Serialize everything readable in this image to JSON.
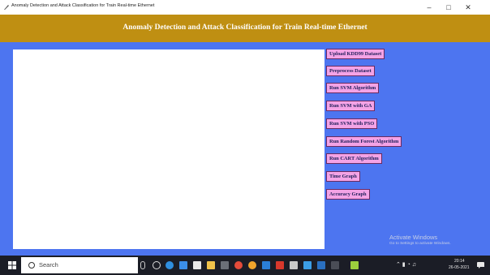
{
  "window": {
    "title": "Anomaly Detection and Attack Classification for Train Real-time Ethernet",
    "controls": {
      "minimize": "–",
      "maximize": "□",
      "close": "✕"
    }
  },
  "header": {
    "title": "Anomaly Detection and Attack Classification for Train Real-time Ethernet"
  },
  "buttons": [
    "Upload KDD99 Dataset",
    "Preprocess Dataset",
    "Run SVM Algorithm",
    "Run SVM with GA",
    "Run SVM with PSO",
    "Run Random Forest Algorithm",
    "Run CART Algorithm",
    "Time Graph",
    "Accuracy Graph"
  ],
  "watermark": {
    "line1": "Activate Windows",
    "line2": "Go to Settings to activate Windows."
  },
  "taskbar": {
    "search_label": "Search",
    "icons": [
      "windows-start-icon",
      "microphone-icon",
      "task-view-icon",
      "edge-icon",
      "mail-icon",
      "store-icon",
      "file-explorer-icon",
      "app-icon",
      "chrome-icon",
      "app-icon",
      "app-icon",
      "app-icon",
      "app-icon",
      "app-icon",
      "app-icon",
      "app-icon"
    ],
    "tray": {
      "time": "20:14",
      "date": "26-05-2021"
    }
  },
  "colors": {
    "header_bg": "#bf8f12",
    "main_bg": "#4d75f0",
    "button_bg": "#f4a3e6",
    "taskbar_bg": "#1b1d26"
  }
}
